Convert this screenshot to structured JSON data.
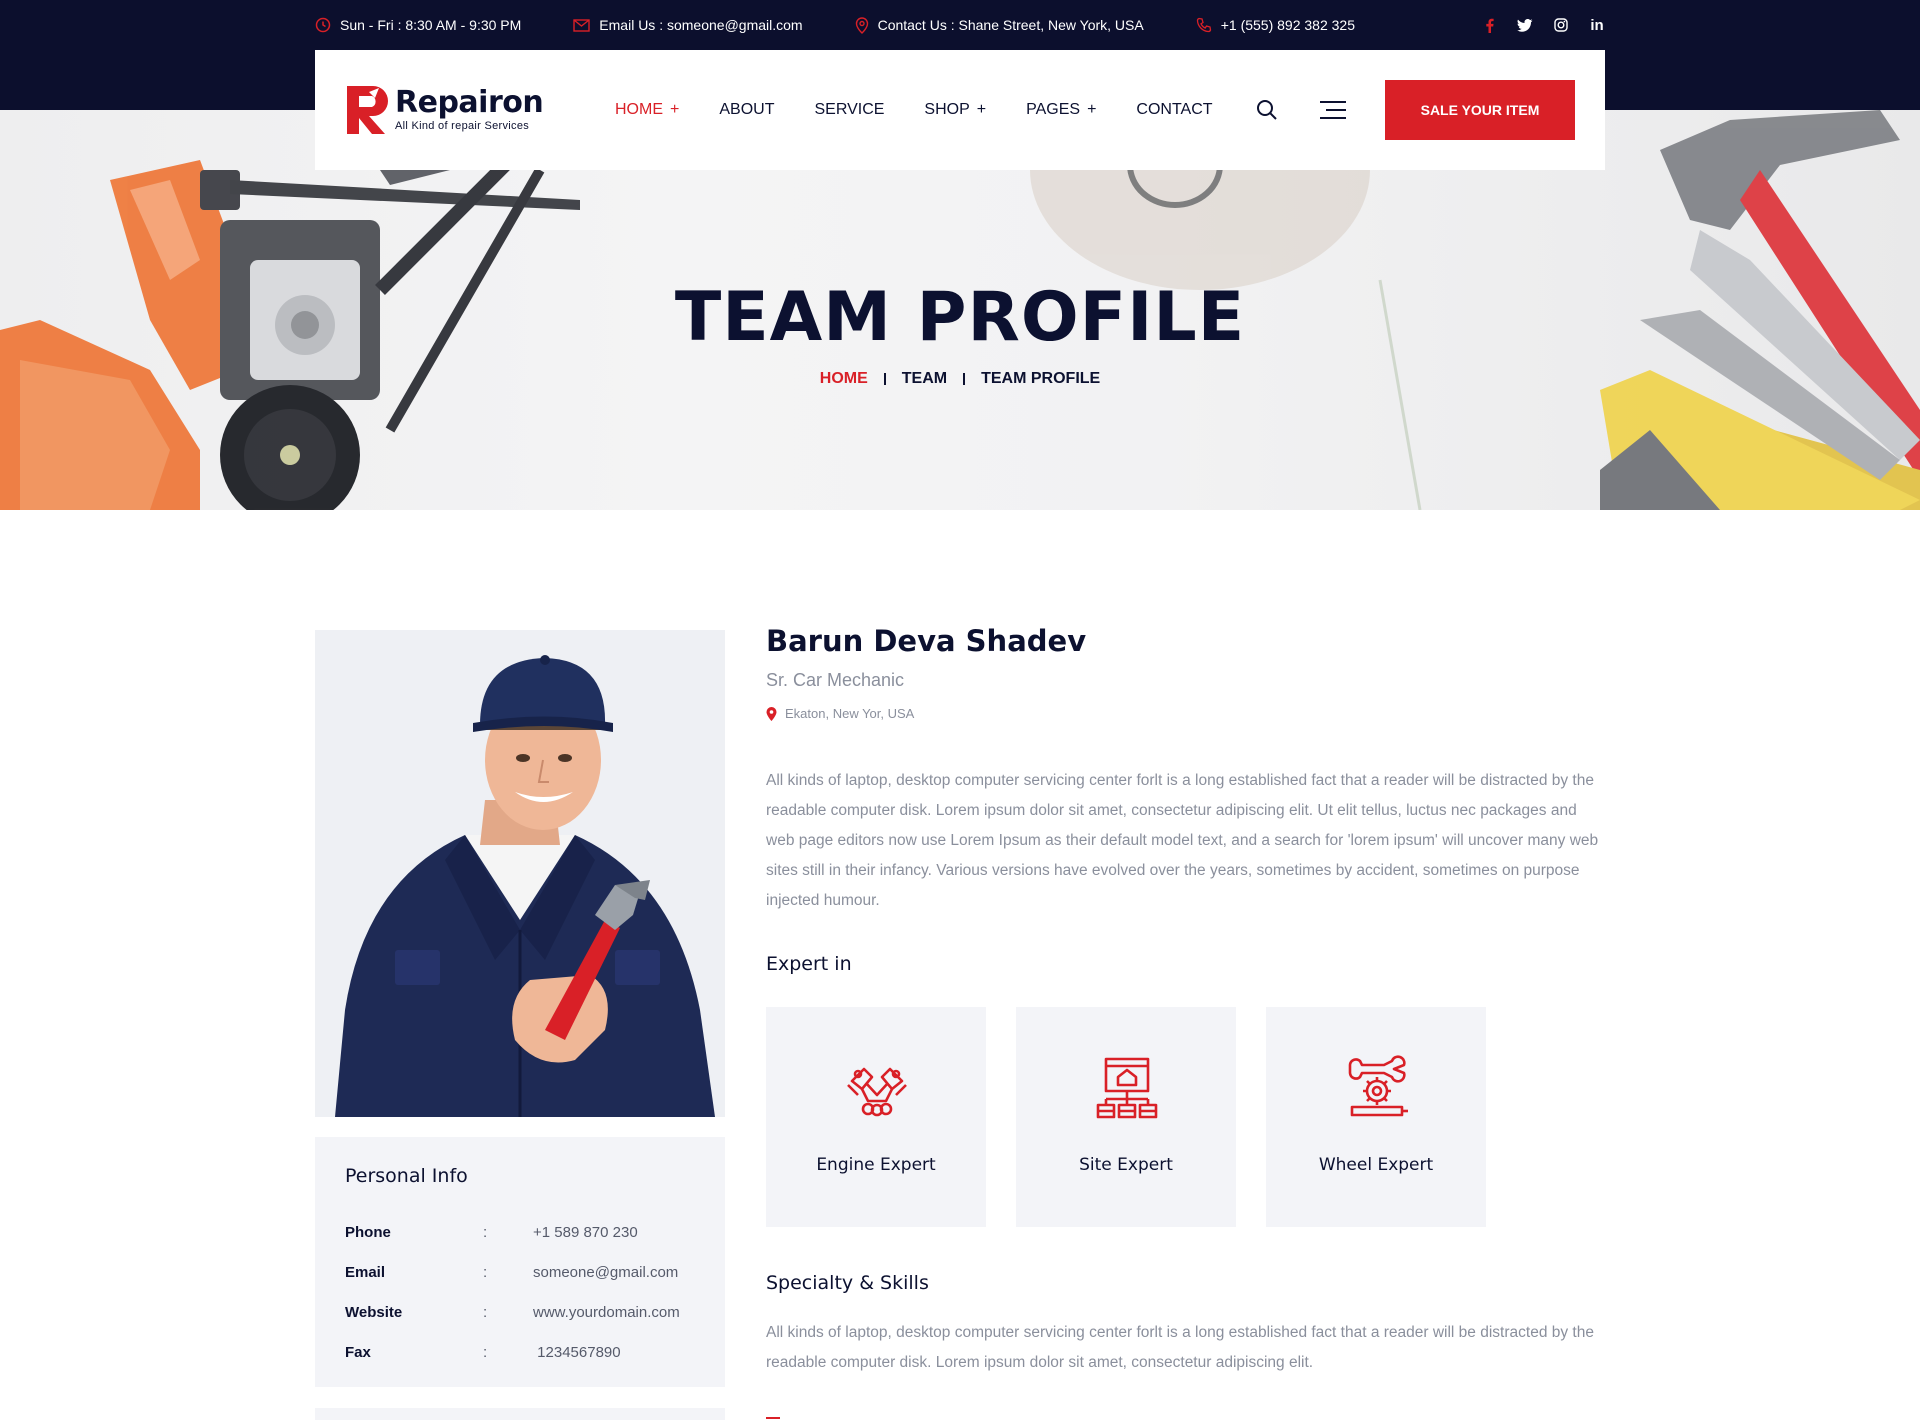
{
  "topbar": {
    "hours": "Sun - Fri : 8:30 AM - 9:30 PM",
    "email": "Email Us : someone@gmail.com",
    "address": "Contact Us : Shane Street, New York, USA",
    "phone": "+1 (555) 892 382 325",
    "social": [
      "facebook-icon",
      "twitter-icon",
      "instagram-icon",
      "linkedin-icon"
    ],
    "social_labels": {
      "linkedin": "in"
    }
  },
  "brand": {
    "name": "Repairon",
    "tagline": "All Kind of repair Services",
    "accent": "#d92027",
    "dark": "#0c1130"
  },
  "nav": {
    "items": [
      {
        "label": "HOME",
        "plus": "+"
      },
      {
        "label": "ABOUT",
        "plus": ""
      },
      {
        "label": "SERVICE",
        "plus": ""
      },
      {
        "label": "SHOP",
        "plus": "+"
      },
      {
        "label": "PAGES",
        "plus": "+"
      },
      {
        "label": "CONTACT",
        "plus": ""
      }
    ],
    "cta": "SALE YOUR ITEM"
  },
  "hero": {
    "title": "TEAM PROFILE",
    "breadcrumb": [
      "HOME",
      "TEAM",
      "TEAM PROFILE"
    ]
  },
  "profile": {
    "name": "Barun Deva Shadev",
    "role": "Sr. Car Mechanic",
    "location": "Ekaton, New Yor, USA",
    "bio": "All kinds of laptop, desktop computer servicing center forlt is a long established fact that a reader will be distracted by the readable computer disk. Lorem ipsum dolor sit amet, consectetur adipiscing elit. Ut elit tellus, luctus nec packages and web page editors now use Lorem Ipsum as their default model text, and a search for 'lorem ipsum' will uncover many web sites still in their infancy. Various versions have evolved over the years, sometimes by accident, sometimes on purpose injected humour."
  },
  "personal_info": {
    "title": "Personal Info",
    "rows": [
      {
        "label": "Phone",
        "colon": ":",
        "value": "+1 589 870 230"
      },
      {
        "label": "Email",
        "colon": ":",
        "value": "someone@gmail.com"
      },
      {
        "label": "Website",
        "colon": ":",
        "value": "www.yourdomain.com"
      },
      {
        "label": "Fax",
        "colon": ":",
        "value": " 1234567890"
      }
    ]
  },
  "expert": {
    "title": "Expert in",
    "items": [
      {
        "label": "Engine Expert",
        "icon": "engine-icon"
      },
      {
        "label": "Site Expert",
        "icon": "site-icon"
      },
      {
        "label": "Wheel Expert",
        "icon": "wheel-gear-icon"
      }
    ]
  },
  "skills": {
    "title": "Specialty & Skills",
    "text": "All kinds of laptop, desktop computer servicing center forlt is a long established fact that a reader will be distracted by the readable computer disk. Lorem ipsum dolor sit amet, consectetur adipiscing elit."
  }
}
